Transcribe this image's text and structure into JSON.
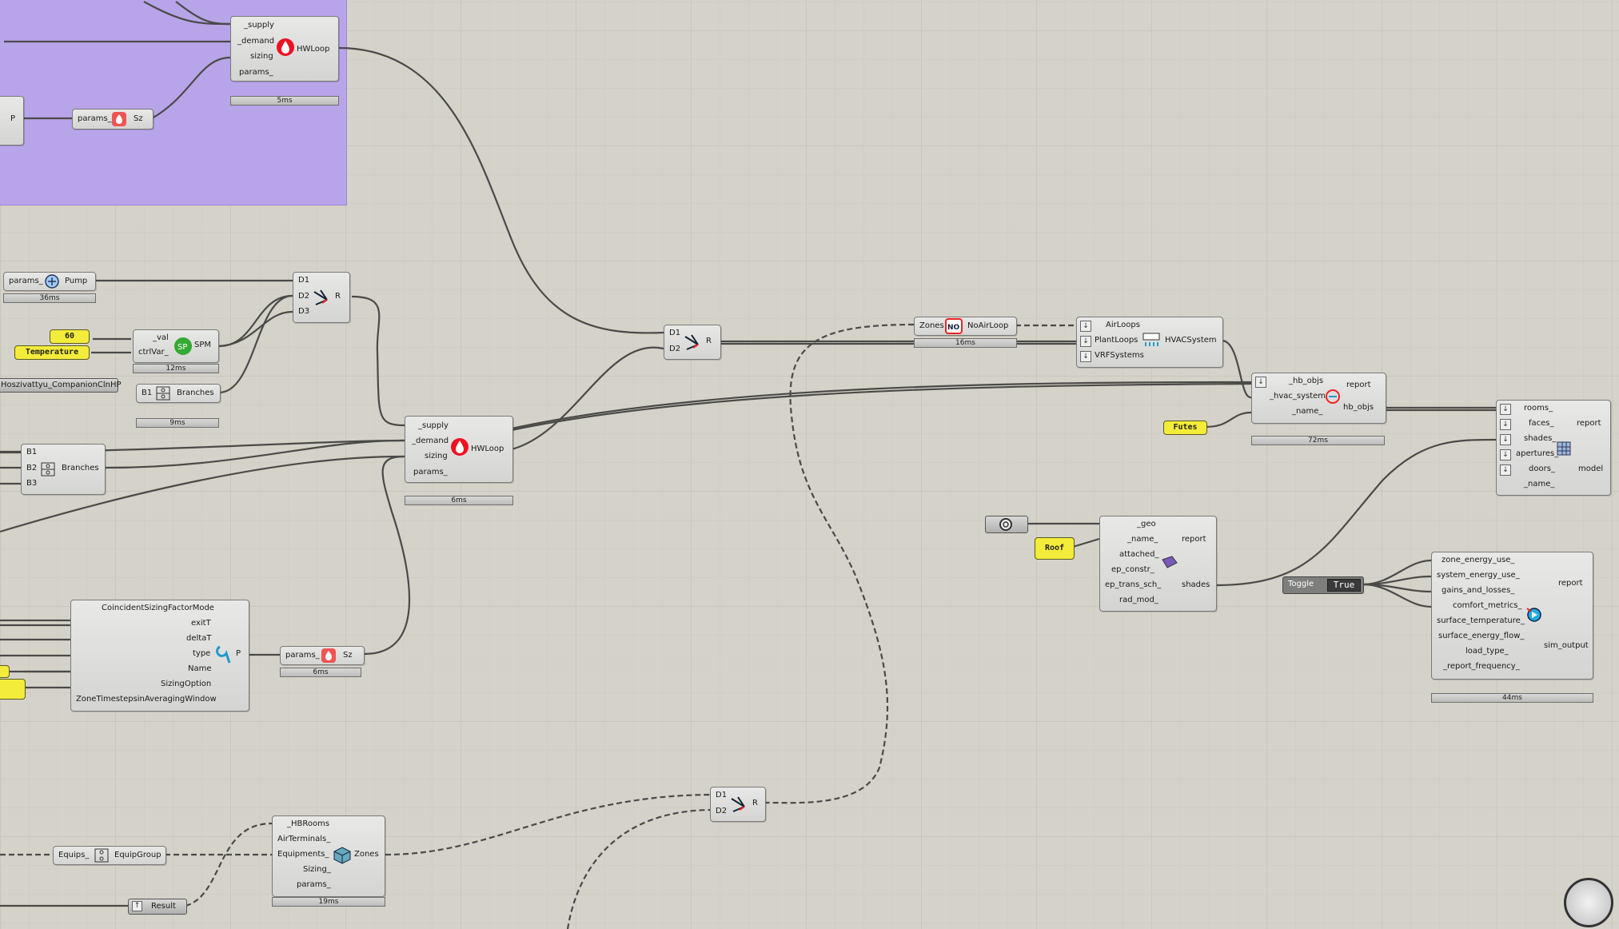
{
  "app": {
    "name": "Grasshopper canvas"
  },
  "colors": {
    "canvas": "#d5d2c9",
    "group": "#b8a4e8",
    "panel": "#f3ec3a",
    "wire": "#4a4a48"
  },
  "components": {
    "hwloop_top": {
      "inputs": [
        "_supply",
        "_demand",
        "sizing",
        "params_"
      ],
      "name": "HWLoop",
      "timer": "5ms"
    },
    "sz_top": {
      "input": "params_",
      "output": "Sz"
    },
    "p_left": {
      "label": "P"
    },
    "pump": {
      "input": "params_",
      "output": "Pump",
      "timer": "36ms"
    },
    "merge1": {
      "inputs": [
        "D1",
        "D2",
        "D3"
      ],
      "output": "R"
    },
    "panel_60": {
      "text": "60"
    },
    "panel_temp": {
      "text": "Temperature"
    },
    "spm": {
      "inputs": [
        "_val",
        "ctrlVar_"
      ],
      "name": "SPM",
      "timer": "12ms"
    },
    "hp_label": {
      "text": "Hoszivattyu_CompanionClnHP"
    },
    "branches1": {
      "input": "B1",
      "name": "Branches",
      "timer": "9ms"
    },
    "branches2": {
      "inputs": [
        "B1",
        "B2",
        "B3"
      ],
      "name": "Branches"
    },
    "hwloop_mid": {
      "inputs": [
        "_supply",
        "_demand",
        "sizing",
        "params_"
      ],
      "name": "HWLoop",
      "timer": "6ms"
    },
    "merge2": {
      "inputs": [
        "D1",
        "D2"
      ],
      "output": "R"
    },
    "noairloop": {
      "input": "Zones",
      "name": "NoAirLoop",
      "timer": "16ms"
    },
    "hvac": {
      "inputs": [
        "AirLoops",
        "PlantLoops",
        "VRFSystems"
      ],
      "name": "HVACSystem"
    },
    "assign": {
      "inputs": [
        "_hb_objs",
        "_hvac_system",
        "_name_"
      ],
      "outputs": [
        "report",
        "hb_objs"
      ],
      "timer": "72ms"
    },
    "panel_futes": {
      "text": "Futes"
    },
    "model": {
      "inputs": [
        "rooms_",
        "faces_",
        "shades_",
        "apertures_",
        "doors_",
        "_name_"
      ],
      "outputs": [
        "report",
        "model"
      ]
    },
    "panel_roof": {
      "text": "Roof"
    },
    "shade": {
      "inputs": [
        "_geo",
        "_name_",
        "attached_",
        "ep_constr_",
        "ep_trans_sch_",
        "rad_mod_"
      ],
      "outputs": [
        "report",
        "shades"
      ]
    },
    "toggle": {
      "label": "Toggle",
      "value": "True"
    },
    "simout": {
      "inputs": [
        "zone_energy_use_",
        "system_energy_use_",
        "gains_and_losses_",
        "comfort_metrics_",
        "surface_temperature_",
        "surface_energy_flow_",
        "load_type_",
        "_report_frequency_"
      ],
      "outputs": [
        "report",
        "sim_output"
      ],
      "timer": "44ms"
    },
    "sizingp": {
      "inputs": [
        "CoincidentSizingFactorMode",
        "exitT",
        "deltaT",
        "type",
        "Name",
        "SizingOption",
        "ZoneTimestepsinAveragingWindow"
      ],
      "output": "P"
    },
    "sz_bot": {
      "input": "params_",
      "output": "Sz",
      "timer": "6ms"
    },
    "merge3": {
      "inputs": [
        "D1",
        "D2"
      ],
      "output": "R"
    },
    "zones": {
      "inputs": [
        "_HBRooms",
        "AirTerminals_",
        "Equipments_",
        "Sizing_",
        "params_"
      ],
      "output": "Zones",
      "timer": "19ms"
    },
    "equipgroup": {
      "input": "Equips_",
      "name": "EquipGroup"
    },
    "result": {
      "text": "Result"
    }
  }
}
